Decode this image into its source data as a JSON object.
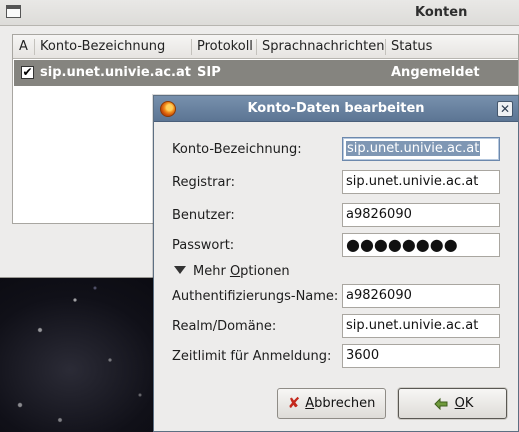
{
  "main_window": {
    "title": "Konten",
    "columns": [
      "A",
      "Konto-Bezeichnung",
      "Protokoll",
      "Sprachnachrichten",
      "Status"
    ],
    "rows": [
      {
        "enabled": true,
        "account": "sip.unet.univie.ac.at",
        "protocol": "SIP",
        "voicemail": "",
        "status": "Angemeldet"
      }
    ]
  },
  "dialog": {
    "title": "Konto-Daten bearbeiten",
    "fields": {
      "account_label": "Konto-Bezeichnung:",
      "account_value": "sip.unet.univie.ac.at",
      "registrar_label": "Registrar:",
      "registrar_value": "sip.unet.univie.ac.at",
      "user_label": "Benutzer:",
      "user_value": "a9826090",
      "password_label": "Passwort:",
      "password_value": "●●●●●●●●",
      "auth_label": "Authentifizierungs-Name:",
      "auth_value": "a9826090",
      "realm_label": "Realm/Domäne:",
      "realm_value": "sip.unet.univie.ac.at",
      "timeout_label": "Zeitlimit für Anmeldung:",
      "timeout_value": "3600"
    },
    "more_options": {
      "prefix": "Mehr ",
      "accesskey": "O",
      "rest": "ptionen"
    },
    "buttons": {
      "cancel": {
        "accesskey": "A",
        "rest": "bbrechen"
      },
      "ok": {
        "accesskey": "O",
        "rest": "K"
      }
    }
  },
  "icons": {
    "window_icon": "window-icon",
    "dialog_icon": "firefox-icon",
    "close": "close-icon",
    "expander": "triangle-down-icon",
    "cancel": "cancel-x-icon",
    "ok": "ok-arrow-icon"
  }
}
